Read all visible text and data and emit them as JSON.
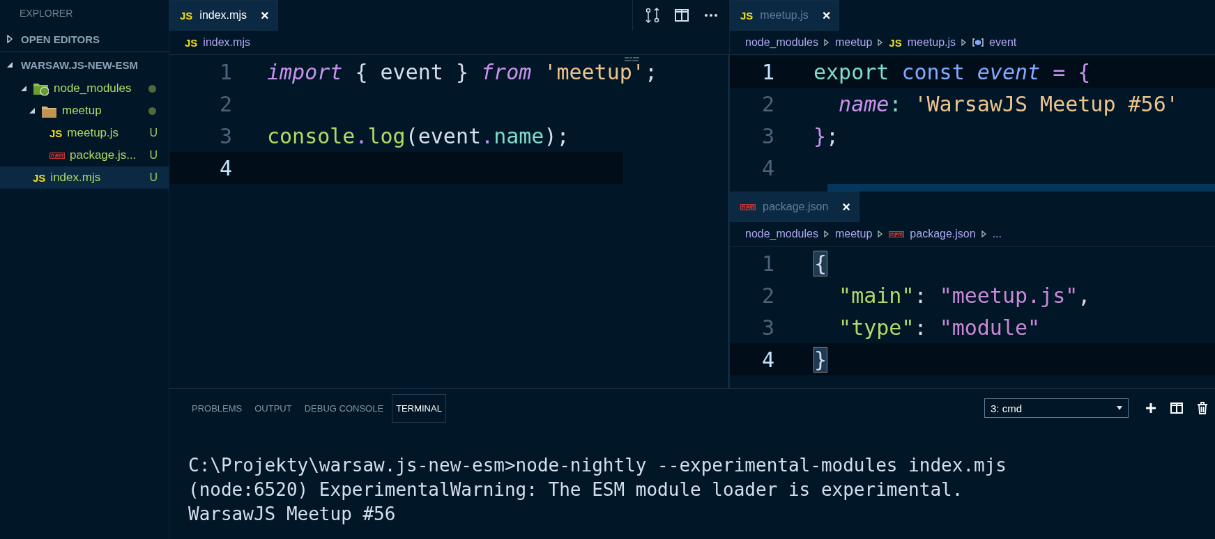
{
  "sidebar": {
    "title": "EXPLORER",
    "sections": [
      {
        "label": "OPEN EDITORS",
        "expanded": false
      },
      {
        "label": "WARSAW.JS-NEW-ESM",
        "expanded": true,
        "items": [
          {
            "name": "node_modules",
            "kind": "node-folder",
            "expanded": true,
            "modified": true,
            "selected": false,
            "children": [
              {
                "name": "meetup",
                "kind": "folder",
                "expanded": true,
                "modified": true,
                "selected": false,
                "children": [
                  {
                    "name": "meetup.js",
                    "kind": "js",
                    "icon_text": "JS",
                    "badge": "U",
                    "selected": false
                  },
                  {
                    "name": "package.js...",
                    "kind": "npm",
                    "badge": "U",
                    "selected": false
                  }
                ]
              }
            ]
          },
          {
            "name": "index.mjs",
            "kind": "js",
            "icon_text": "JS",
            "badge": "U",
            "selected": true
          }
        ]
      }
    ]
  },
  "left_group": {
    "focused": true,
    "tabs": [
      {
        "label": "index.mjs",
        "kind": "js",
        "icon_text": "JS",
        "selected": true,
        "close": "×"
      }
    ],
    "breadcrumb": [
      {
        "text": "index.mjs",
        "kind": "js",
        "icon_text": "JS"
      }
    ],
    "lines": [
      {
        "number": "1",
        "current": false,
        "tokens": [
          {
            "text": "import",
            "kind": "keyword"
          },
          {
            "text": " { event } ",
            "kind": "plain"
          },
          {
            "text": "from",
            "kind": "keyword"
          },
          {
            "text": " 'meetup'",
            "kind": "string"
          },
          {
            "text": ";",
            "kind": "plain"
          }
        ]
      },
      {
        "number": "2",
        "current": false
      },
      {
        "number": "3",
        "current": false,
        "tokens": [
          {
            "text": "console",
            "kind": "function"
          },
          {
            "text": ".",
            "kind": "operator"
          },
          {
            "text": "log",
            "kind": "function"
          },
          {
            "text": "(event",
            "kind": "plain"
          },
          {
            "text": ".",
            "kind": "operator"
          },
          {
            "text": "name",
            "kind": "property"
          },
          {
            "text": ");",
            "kind": "plain"
          }
        ]
      },
      {
        "number": "4",
        "current": true
      }
    ]
  },
  "right_groups": [
    {
      "focused": false,
      "tabs": [
        {
          "label": "meetup.js",
          "kind": "js",
          "icon_text": "JS",
          "selected": true,
          "close": "×"
        }
      ],
      "breadcrumb": [
        {
          "text": "node_modules"
        },
        {
          "text": "meetup"
        },
        {
          "text": "meetup.js",
          "kind": "js",
          "icon_text": "JS"
        },
        {
          "text": "event",
          "kind": "symbol"
        }
      ],
      "lines": [
        {
          "number": "1",
          "current": true,
          "tokens": [
            {
              "text": "export ",
              "kind": "property"
            },
            {
              "text": "const ",
              "kind": "storage"
            },
            {
              "text": "event",
              "kind": "storage-italic"
            },
            {
              "text": " = {",
              "kind": "operator"
            }
          ]
        },
        {
          "number": "2",
          "current": false,
          "tokens": [
            {
              "text": "  name",
              "kind": "keyword"
            },
            {
              "text": ": ",
              "kind": "property"
            },
            {
              "text": "'WarsawJS Meetup #56'",
              "kind": "string"
            }
          ]
        },
        {
          "number": "3",
          "current": false,
          "tokens": [
            {
              "text": "}",
              "kind": "operator"
            },
            {
              "text": ";",
              "kind": "plain"
            }
          ]
        },
        {
          "number": "4",
          "current": false
        }
      ]
    },
    {
      "focused": false,
      "tabs": [
        {
          "label": "package.json",
          "kind": "npm",
          "selected": true,
          "close": "×"
        }
      ],
      "breadcrumb": [
        {
          "text": "node_modules"
        },
        {
          "text": "meetup"
        },
        {
          "text": "package.json",
          "kind": "npm"
        },
        {
          "text": "..."
        }
      ],
      "lines": [
        {
          "number": "1",
          "current": false,
          "tokens": [
            {
              "text": "{",
              "kind": "bracket-match"
            }
          ]
        },
        {
          "number": "2",
          "current": false,
          "tokens": [
            {
              "text": "  \"main\"",
              "kind": "function"
            },
            {
              "text": ": ",
              "kind": "plain"
            },
            {
              "text": "\"meetup.js\"",
              "kind": "value"
            },
            {
              "text": ",",
              "kind": "plain"
            }
          ]
        },
        {
          "number": "3",
          "current": false,
          "tokens": [
            {
              "text": "  \"type\"",
              "kind": "function"
            },
            {
              "text": ": ",
              "kind": "plain"
            },
            {
              "text": "\"module\"",
              "kind": "value"
            }
          ]
        },
        {
          "number": "4",
          "current": true,
          "tokens": [
            {
              "text": "}",
              "kind": "bracket-match"
            }
          ]
        }
      ]
    }
  ],
  "panel": {
    "tabs": [
      {
        "label": "PROBLEMS",
        "selected": false
      },
      {
        "label": "OUTPUT",
        "selected": false
      },
      {
        "label": "DEBUG CONSOLE",
        "selected": false
      },
      {
        "label": "TERMINAL",
        "selected": true
      }
    ],
    "terminal_select": {
      "value": "3: cmd"
    },
    "terminal_lines": [
      "C:\\Projekty\\warsaw.js-new-esm>node-nightly --experimental-modules index.mjs",
      "(node:6520) ExperimentalWarning: The ESM module loader is experimental.",
      "WarsawJS Meetup #56"
    ]
  }
}
